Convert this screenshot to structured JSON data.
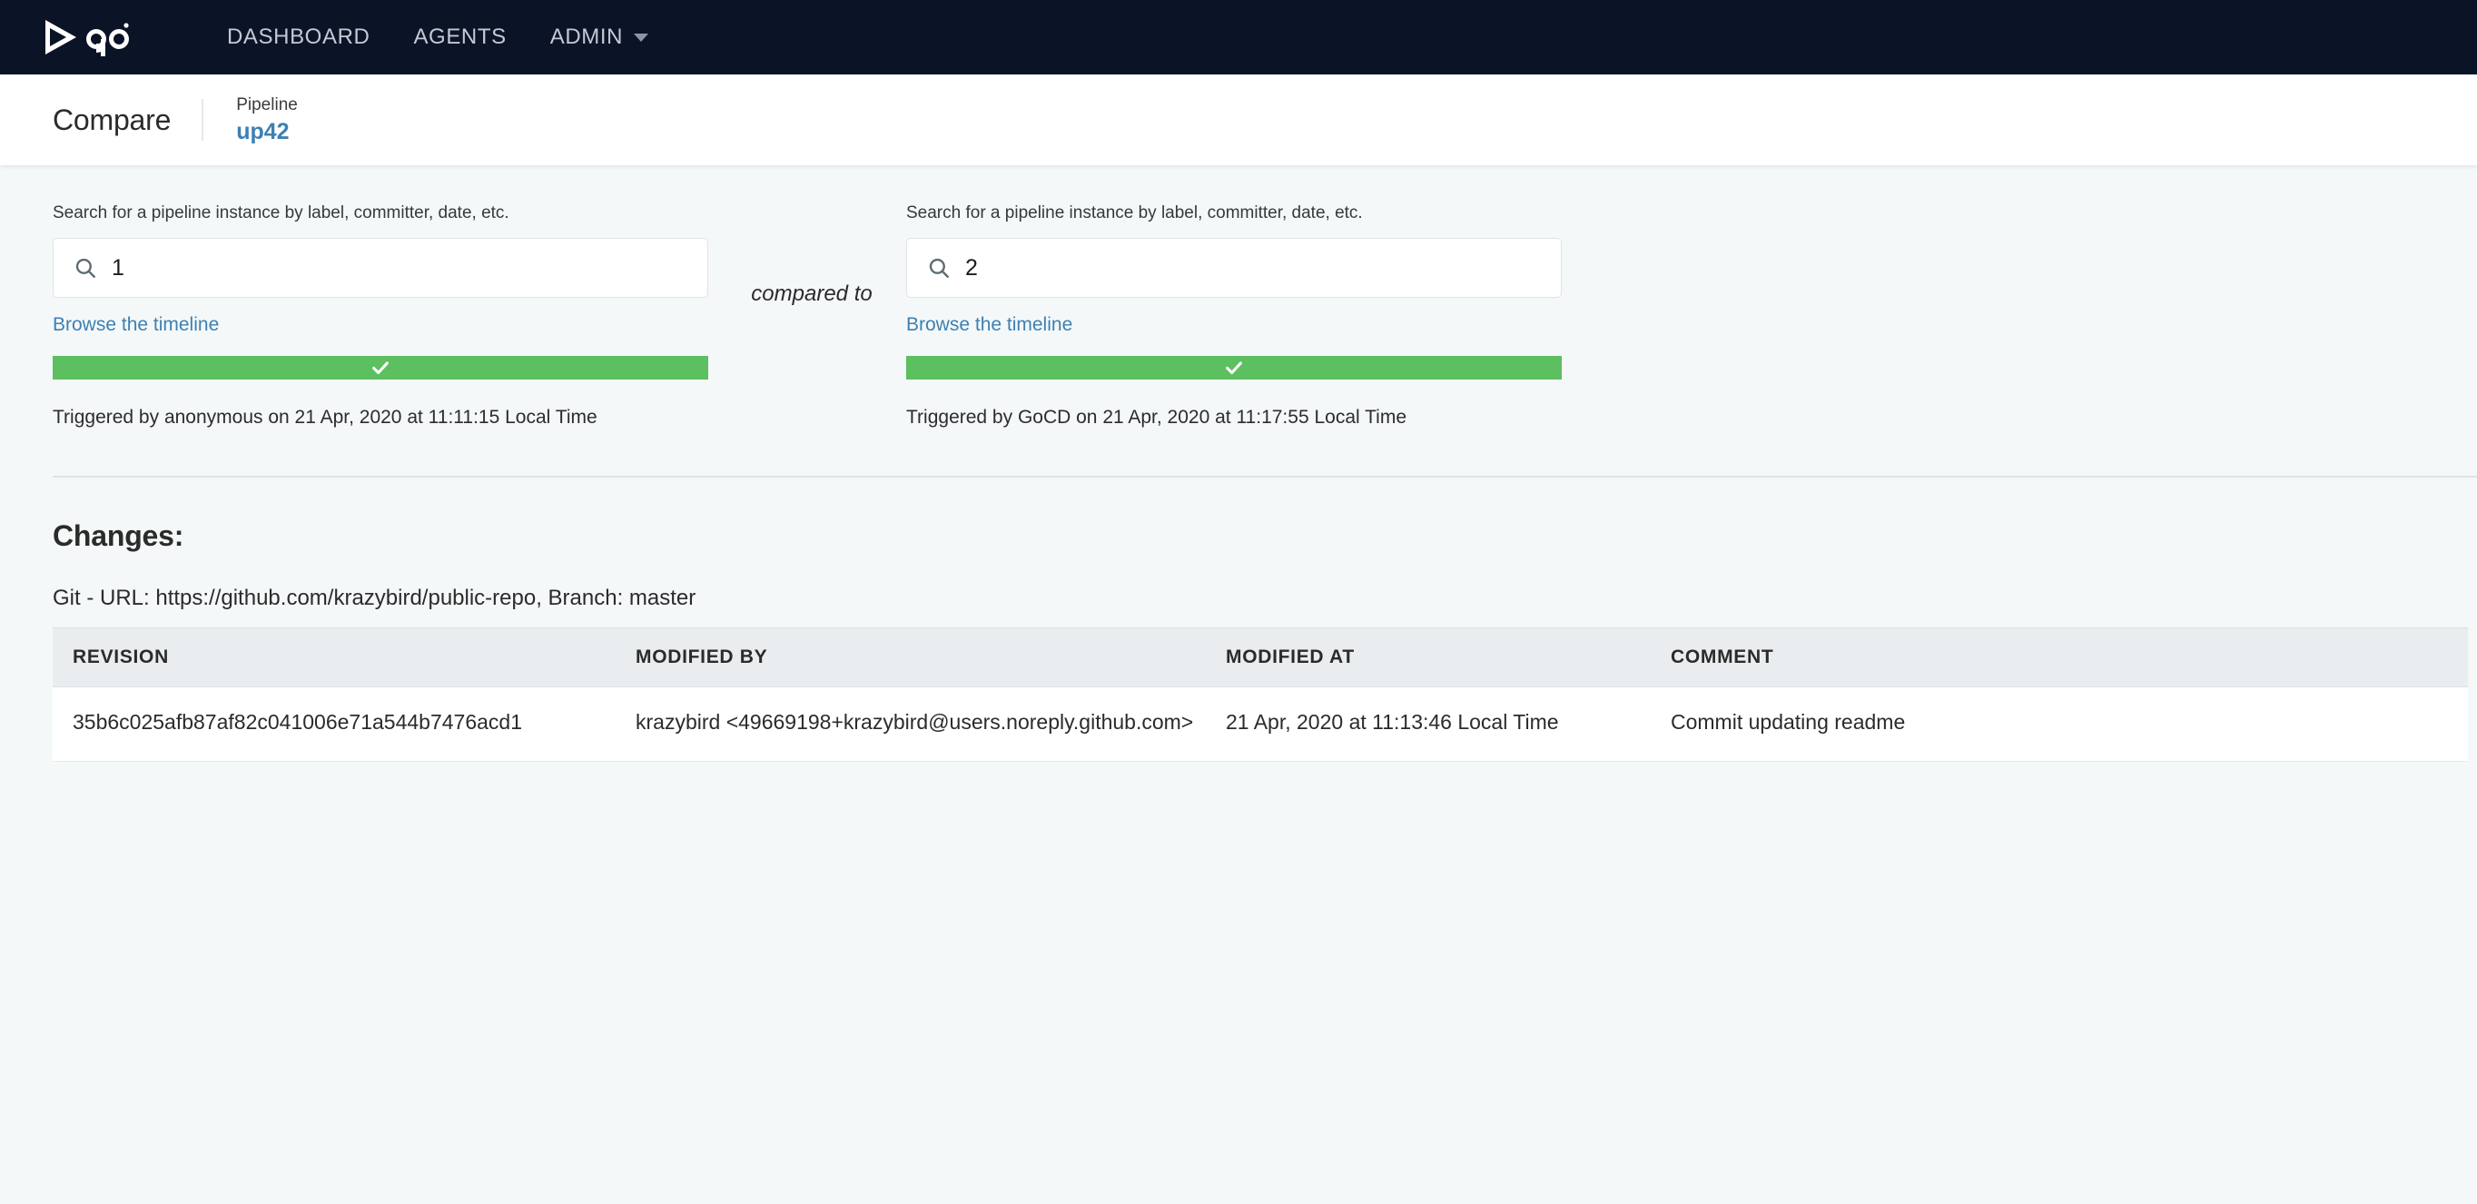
{
  "nav": {
    "logo_name": "gocd-logo",
    "logo_text": "go",
    "items": [
      {
        "label": "DASHBOARD",
        "name": "nav-dashboard"
      },
      {
        "label": "AGENTS",
        "name": "nav-agents"
      },
      {
        "label": "ADMIN",
        "name": "nav-admin",
        "has_caret": true
      }
    ]
  },
  "header": {
    "title": "Compare",
    "pipeline_label": "Pipeline",
    "pipeline_name": "up42"
  },
  "compare": {
    "compared_to": "compared to",
    "left": {
      "search_label": "Search for a pipeline instance by label, committer, date, etc.",
      "search_value": "1",
      "search_placeholder": "Search for a pipeline instance by label, committer, date, etc.",
      "browse_link": "Browse the timeline",
      "status": "passed",
      "status_color": "#5cbf60",
      "trigger_text": "Triggered by anonymous on 21 Apr, 2020 at 11:11:15 Local Time"
    },
    "right": {
      "search_label": "Search for a pipeline instance by label, committer, date, etc.",
      "search_value": "2",
      "search_placeholder": "Search for a pipeline instance by label, committer, date, etc.",
      "browse_link": "Browse the timeline",
      "status": "passed",
      "status_color": "#5cbf60",
      "trigger_text": "Triggered by GoCD on 21 Apr, 2020 at 11:17:55 Local Time"
    }
  },
  "changes": {
    "title": "Changes:",
    "material": "Git - URL: https://github.com/krazybird/public-repo, Branch: master",
    "columns": [
      "REVISION",
      "MODIFIED BY",
      "MODIFIED AT",
      "COMMENT"
    ],
    "rows": [
      {
        "revision": "35b6c025afb87af82c041006e71a544b7476acd1",
        "modified_by": "krazybird <49669198+krazybird@users.noreply.github.com>",
        "modified_at": "21 Apr, 2020 at 11:13:46 Local Time",
        "comment": "Commit updating readme"
      }
    ]
  },
  "colors": {
    "nav_background": "#0b1326",
    "accent_link": "#3d80b3",
    "page_background": "#f4f8f9",
    "status_green": "#5cbf60",
    "table_header_background": "#e9edef"
  }
}
